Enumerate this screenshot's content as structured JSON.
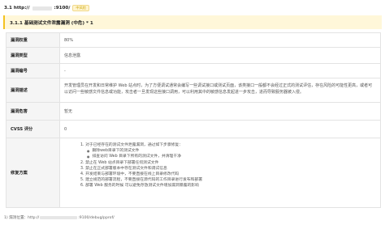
{
  "heading": {
    "prefix": "3.1 http://",
    "suffix": ":9100/",
    "badge": "中风险"
  },
  "section_title": "3.1.1 基础测试文件泄露漏洞 (中危) * 1",
  "rows": [
    {
      "label": "漏洞权重",
      "value": "80%"
    },
    {
      "label": "漏洞类型",
      "value": "信息泄露"
    },
    {
      "label": "漏洞编号",
      "value": "-"
    },
    {
      "label": "漏洞描述",
      "value": "开发管理员在开发和日常维护 Web 站点时，为了方便调试通常会编写一些调试接口或测试页面，该类接口一般都不会经过正式的测试评估，存在风险的可能性更高，或者可以访问一些敏感文件信息或功能，攻击者一旦发现这些接口调用，可以利用其中的敏感信息发起进一步攻击，进而导致服务器被入侵。"
    },
    {
      "label": "漏洞危害",
      "value": "暂无"
    },
    {
      "label": "CVSS 评分",
      "value": "0"
    },
    {
      "label": "修复方案"
    }
  ],
  "remediation": [
    {
      "text": "1. 对于已经存在的测试文件泄露漏洞，通过如下步骤修复：",
      "sub": [
        "删除web目录下的测试文件",
        "排查访问 Web 目录下所有的测试文件，并清理干净"
      ]
    },
    {
      "text": "2. 禁止在 Web 站点目录下部署任何测试文件"
    },
    {
      "text": "3. 禁止在正式部署版本中存在测试文件和调试信息"
    },
    {
      "text": "4. 开发结束与部署环境中，不要直接在线上目录修改代码"
    },
    {
      "text": "5. 建立规范的部署流程，不要直接在源代码的工作目录进行发布和部署"
    },
    {
      "text": "6. 部署 Web 服务的时候 可以避免存放测试文件增加漏洞暴露的影响"
    }
  ],
  "footnote": {
    "prefix": "1) 漏洞位置：http://",
    "suffix": ":9100/debug/pprof/"
  }
}
